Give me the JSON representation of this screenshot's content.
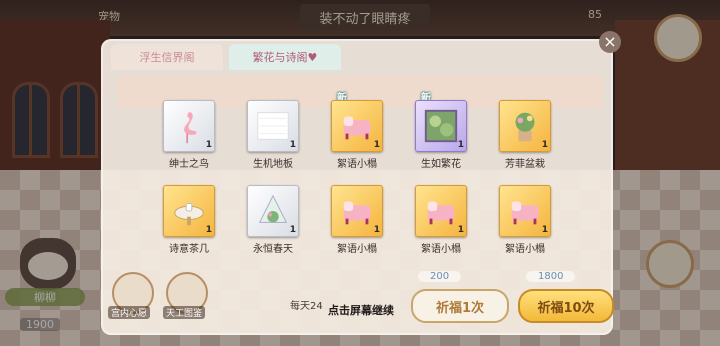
{
  "top_bar": {
    "title": "装不动了眼睛疼",
    "left_label": "宠物",
    "stat": "85"
  },
  "tabs": [
    {
      "label": "浮生信界阁",
      "active": false
    },
    {
      "label": "繁花与诗阁♥",
      "active": true
    }
  ],
  "items": [
    {
      "name": "绅士之鸟",
      "qty": "1",
      "rarity": "white",
      "is_new": false,
      "art": "flamingo"
    },
    {
      "name": "生机地板",
      "qty": "1",
      "rarity": "white",
      "is_new": false,
      "art": "floor"
    },
    {
      "name": "絮语小榻",
      "qty": "1",
      "rarity": "gold",
      "is_new": true,
      "art": "bed"
    },
    {
      "name": "生如繁花",
      "qty": "1",
      "rarity": "purple",
      "is_new": true,
      "art": "painting"
    },
    {
      "name": "芳菲盆栽",
      "qty": "1",
      "rarity": "gold",
      "is_new": false,
      "art": "plant"
    },
    {
      "name": "诗意茶几",
      "qty": "1",
      "rarity": "gold",
      "is_new": false,
      "art": "table"
    },
    {
      "name": "永恒春天",
      "qty": "1",
      "rarity": "white",
      "is_new": false,
      "art": "terrarium"
    },
    {
      "name": "絮语小榻",
      "qty": "1",
      "rarity": "gold",
      "is_new": false,
      "art": "bed"
    },
    {
      "name": "絮语小榻",
      "qty": "1",
      "rarity": "gold",
      "is_new": false,
      "art": "bed"
    },
    {
      "name": "絮语小榻",
      "qty": "1",
      "rarity": "gold",
      "is_new": false,
      "art": "bed"
    }
  ],
  "new_badge": "新",
  "daily_hint": "每天24",
  "continue_hint": "点击屏幕继续",
  "cost_single": "200",
  "cost_ten": "1800",
  "pray_single": "祈福1次",
  "pray_ten": "祈福10次",
  "bottom_left": {
    "name": "柳柳",
    "sub": "1900"
  },
  "bottom_buttons": [
    {
      "label": "宫内心愿"
    },
    {
      "label": "天工图鉴"
    }
  ],
  "colors": {
    "accent_gold": "#f3b939",
    "tab_active_text": "#b05c78",
    "new_badge_glow": "#1c6b6a"
  }
}
